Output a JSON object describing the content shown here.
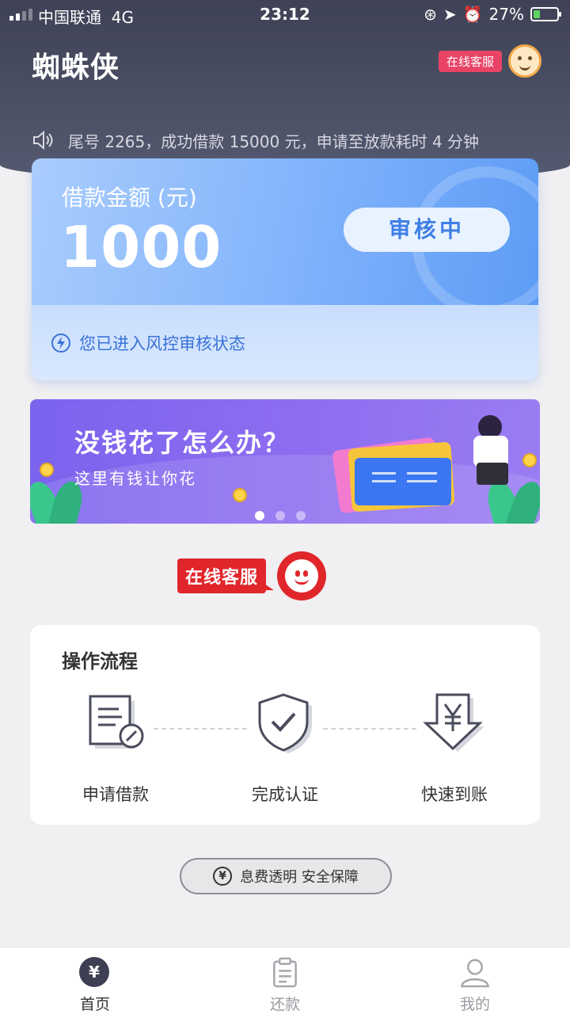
{
  "status_bar": {
    "carrier": "中国联通",
    "network": "4G",
    "time": "23:12",
    "battery": "27%"
  },
  "header": {
    "app_title": "蜘蛛侠",
    "cs_label": "在线客服"
  },
  "notice": {
    "text": "尾号 2265，成功借款 15000 元，申请至放款耗时 4 分钟"
  },
  "loan_card": {
    "label": "借款金额 (元)",
    "amount": "1000",
    "status": "审核中",
    "footer_text": "您已进入风控审核状态"
  },
  "banner": {
    "headline": "没钱花了怎么办？",
    "subline": "这里有钱让你花",
    "active_dot_index": 0,
    "dot_count": 3
  },
  "cs_big": {
    "label": "在线客服"
  },
  "process": {
    "title": "操作流程",
    "steps": [
      {
        "label": "申请借款",
        "icon": "document-edit-icon"
      },
      {
        "label": "完成认证",
        "icon": "shield-check-icon"
      },
      {
        "label": "快速到账",
        "icon": "yen-arrow-down-icon"
      }
    ]
  },
  "guarantee": {
    "text": "息费透明 安全保障"
  },
  "tabbar": {
    "items": [
      {
        "label": "首页",
        "icon": "yen-home-icon",
        "active": true
      },
      {
        "label": "还款",
        "icon": "clipboard-icon",
        "active": false
      },
      {
        "label": "我的",
        "icon": "person-icon",
        "active": false
      }
    ]
  },
  "colors": {
    "header_bg": "#3f4256",
    "card_blue": "#5b9bf5",
    "banner_purple": "#8d6cf0",
    "cs_red": "#e1262b",
    "badge_pink": "#e94366"
  }
}
